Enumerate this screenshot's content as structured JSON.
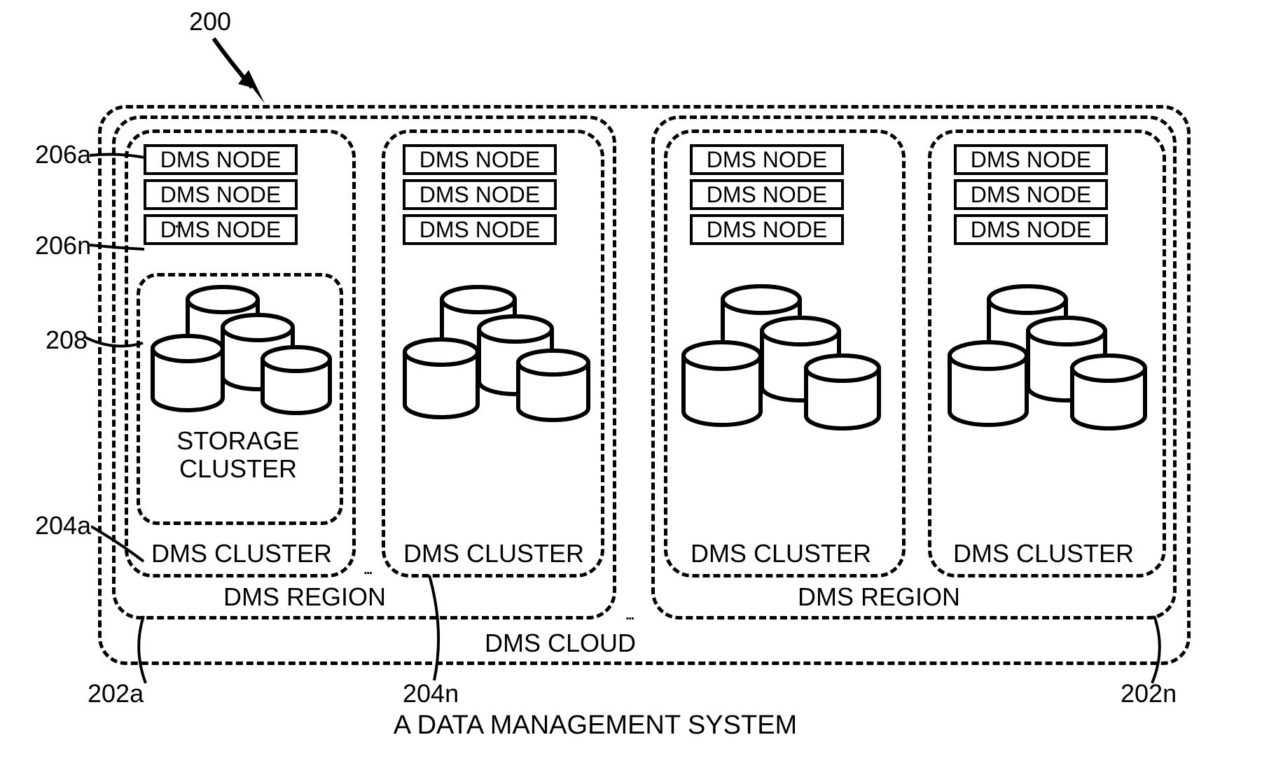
{
  "refs": {
    "r200": "200",
    "r206a": "206a",
    "r206n": "206n",
    "r208": "208",
    "r204a": "204a",
    "r202a": "202a",
    "r204n": "204n",
    "r202n": "202n"
  },
  "labels": {
    "dms_node": "DMS NODE",
    "storage_cluster": "STORAGE CLUSTER",
    "dms_cluster": "DMS CLUSTER",
    "dms_region": "DMS REGION",
    "dms_cloud": "DMS CLOUD",
    "system": "A DATA MANAGEMENT SYSTEM"
  },
  "clusters": [
    {
      "show_storage_box": true,
      "storage_label": true
    },
    {
      "show_storage_box": false,
      "storage_label": false
    },
    {
      "show_storage_box": false,
      "storage_label": false
    },
    {
      "show_storage_box": false,
      "storage_label": false
    }
  ]
}
